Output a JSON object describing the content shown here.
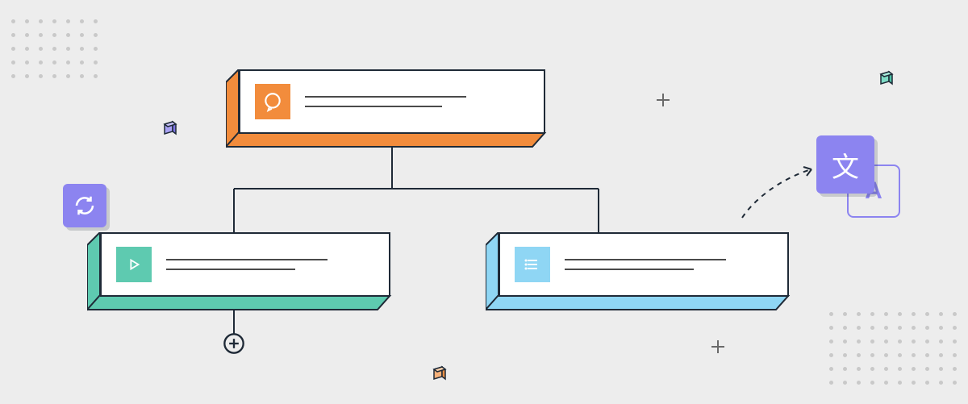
{
  "nodes": {
    "root": {
      "icon": "chat-icon",
      "accent": "#F28C3C"
    },
    "left": {
      "icon": "play-icon",
      "accent": "#5ECAB0"
    },
    "right": {
      "icon": "list-icon",
      "accent": "#8FD6F4"
    }
  },
  "badges": {
    "refresh": {
      "icon": "refresh-icon",
      "color": "#8C84F0"
    },
    "translate": {
      "icon": "translate-icon",
      "color": "#8C84F0",
      "glyph_cjk": "文",
      "glyph_latin": "A"
    }
  },
  "decorations": {
    "add_circle": {
      "icon": "add-circle-icon"
    },
    "plus_marks": 2,
    "cubes": 3,
    "dot_grids": 2
  },
  "colors": {
    "bg": "#EDEDED",
    "outline": "#1f2a37",
    "purple": "#8C84F0",
    "orange": "#F28C3C",
    "teal": "#5ECAB0",
    "sky": "#8FD6F4",
    "cube_orange": "#F2994A",
    "cube_teal": "#5ECAB0"
  }
}
